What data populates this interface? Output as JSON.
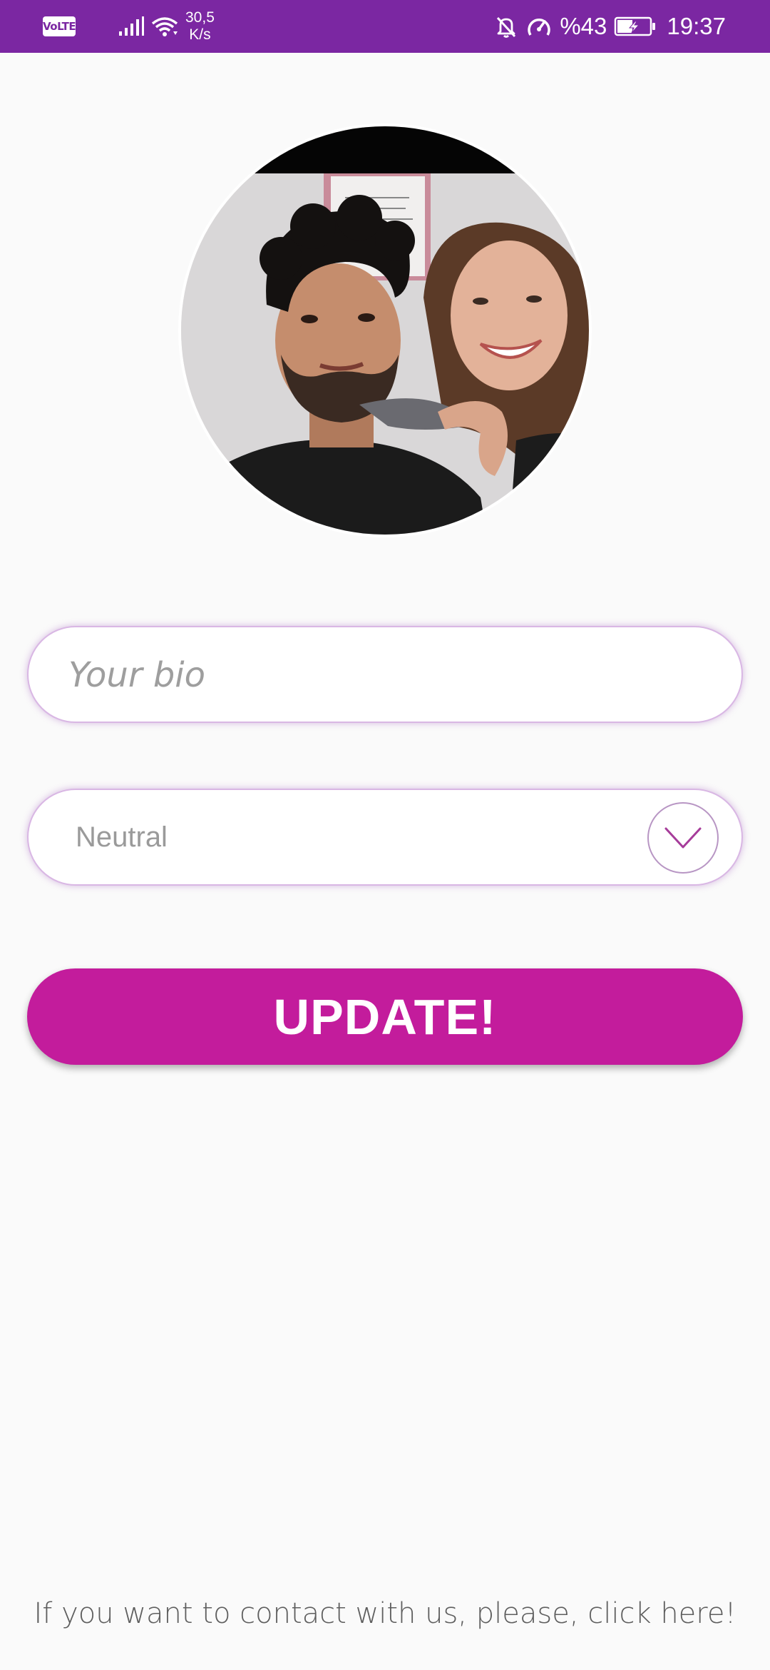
{
  "status_bar": {
    "volte": "VoLTE",
    "net_speed_value": "30,5",
    "net_speed_unit": "K/s",
    "battery_percent": "%43",
    "time": "19:37",
    "icons": [
      "volte-icon",
      "signal-icon",
      "wifi-icon",
      "mute-bell-icon",
      "data-saver-icon",
      "battery-charging-icon"
    ],
    "background": "#7b27a2"
  },
  "profile": {
    "avatar_icon": "profile-photo"
  },
  "bio": {
    "placeholder": "Your bio",
    "value": ""
  },
  "mood_select": {
    "selected": "Neutral",
    "icon": "chevron-down-icon"
  },
  "update_button": {
    "label": "UPDATE!",
    "color": "#c31c9c"
  },
  "footer": {
    "contact_text": "If you want to contact with us, please, click here!"
  },
  "colors": {
    "accent": "#c31c9c",
    "brand_purple": "#7b27a2",
    "background": "#fafafa"
  }
}
